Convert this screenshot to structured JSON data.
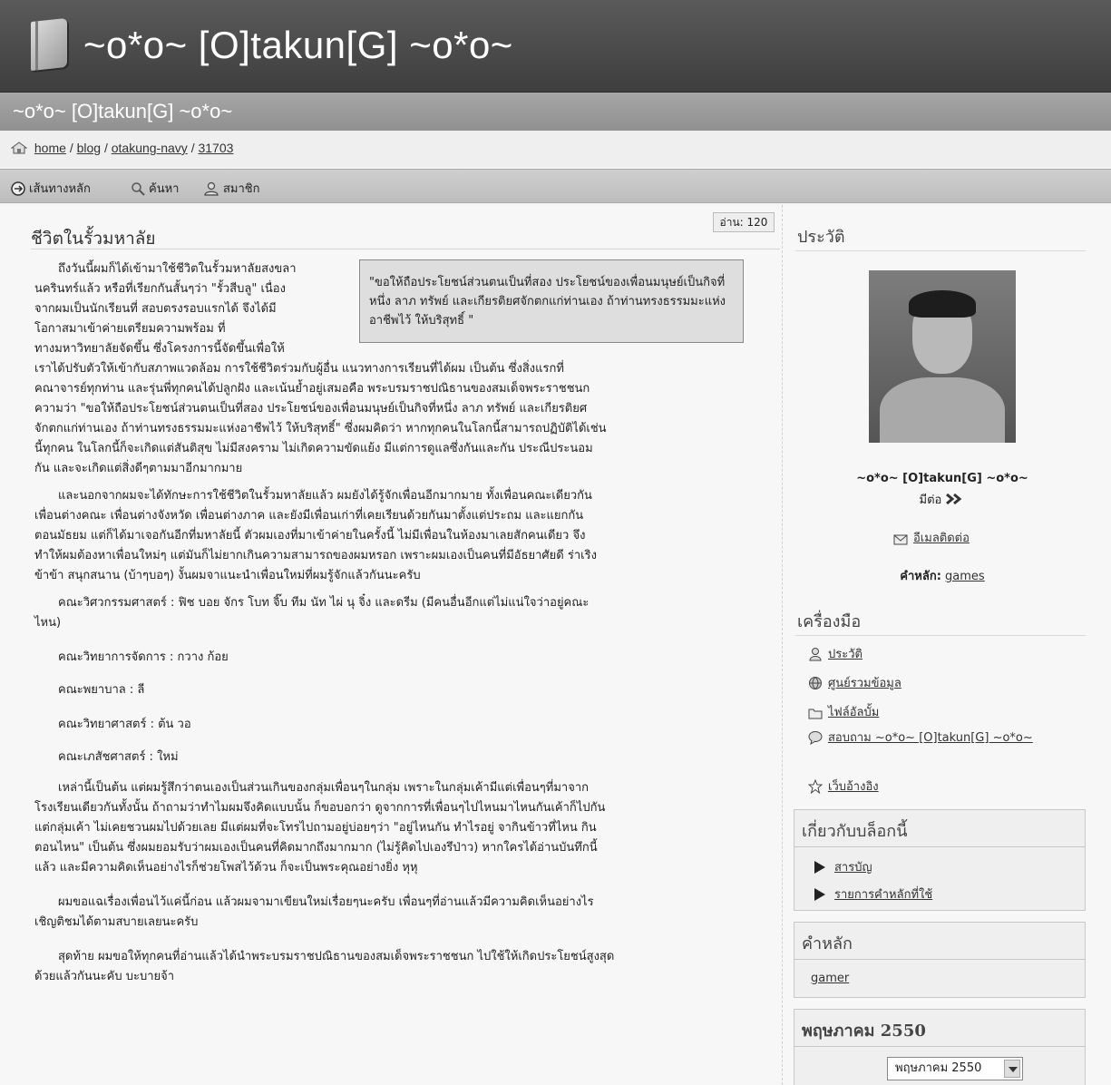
{
  "header": {
    "title": "~o*o~ [O]takun[G] ~o*o~",
    "subtitle": "~o*o~ [O]takun[G] ~o*o~"
  },
  "breadcrumb": {
    "home": "home",
    "blog": "blog",
    "user": "otakung-navy",
    "id": "31703",
    "sep": "/"
  },
  "nav": {
    "main": "เส้นทางหลัก",
    "search": "ค้นหา",
    "members": "สมาชิก"
  },
  "post": {
    "title": "ชีวิตในรั้วมหาลัย",
    "read_count": "อ่าน: 120",
    "quote": "\"ขอให้ถือประโยชน์ส่วนตนเป็นที่สอง ประโยชน์ของเพื่อนมนุษย์เป็นกิจที่หนึ่ง ลาภ ทรัพย์ และเกียรติยศจักตกแก่ท่านเอง ถ้าท่านทรงธรรมมะแห่งอาชีพไว้ ให้บริสุทธิ์ \"",
    "p1_lines": [
      "ถึงวันนี้ผมก็ได้เข้ามาใช้ชีวิตในรั้วมหาลัยสงขลา",
      "นครินทร์แล้ว หรือที่เรียกกันสั้นๆว่า \"รั้วสีบลู\" เนื่อง",
      "จากผมเป็นนักเรียนที่ สอบตรงรอบแรกได้ จึงได้มี",
      "โอกาสมาเข้าค่ายเตรียมความพร้อม ที่",
      "ทางมหาวิทยาลัยจัดขึ้น ซึ่งโครงการนี้จัดขึ้นเพื่อให้",
      "เราได้ปรับตัวให้เข้ากับสภาพแวดล้อม การใช้ชีวิตร่วมกับผู้อื่น แนวทางการเรียนที่ได้ผม เป็นต้น ซึ่งสิ่งแรกที่",
      "คณาจารย์ทุกท่าน และรุ่นพี่ทุกคนได้ปลูกฝัง และเน้นย้ำอยู่เสมอคือ พระบรมราชปณิธานของสมเด็จพระราชชนก",
      "ความว่า \"ขอให้ถือประโยชน์ส่วนตนเป็นที่สอง ประโยชน์ของเพื่อนมนุษย์เป็นกิจที่หนึ่ง ลาภ ทรัพย์ และเกียรติยศ",
      "จักตกแก่ท่านเอง ถ้าท่านทรงธรรมมะแห่งอาชีพไว้ ให้บริสุทธิ์\" ซึ่งผมคิดว่า หากทุกคนในโลกนี้สามารถปฏิบัติได้เช่น",
      "นี้ทุกคน ในโลกนี้ก็จะเกิดแต่สันติสุข ไม่มีสงคราม ไม่เกิดความขัดแย้ง มีแต่การดูแลซึ่งกันและกัน ประณีประนอม",
      "กัน และจะเกิดแต่สิ่งดีๆตามมาอีกมากมาย"
    ],
    "p2_lines": [
      "และนอกจากผมจะได้ทักษะการใช้ชีวิตในรั้วมหาลัยแล้ว ผมยังได้รู้จักเพื่อนอีกมากมาย ทั้งเพื่อนคณะเดียวกัน",
      "เพื่อนต่างคณะ เพื่อนต่างจังหวัด เพื่อนต่างภาค และยังมีเพื่อนเก่าที่เคยเรียนด้วยกันมาตั้งแต่ประถม และแยกกัน",
      "ตอนมัธยม แต่ก็ได้มาเจอกันอีกที่มหาลัยนี้ ตัวผมเองที่มาเข้าค่ายในครั้งนี้ ไม่มีเพื่อนในห้องมาเลยสักคนเดียว จึง",
      "ทำให้ผมต้องหาเพื่อนใหม่ๆ แต่มันก็ไม่ยากเกินความสามารถของผมหรอก เพราะผมเองเป็นคนที่มีอัธยาศัยดี ร่าเริง",
      "ข้าข้า สนุกสนาน (บ้าๆบอๆ) งั้นผมจาแนะนำเพื่อนใหม่ที่ผมรู้จักแล้วกันนะครับ"
    ],
    "p3_lines": [
      "คณะวิศวกรรมศาสตร์ : ฟิช บอย จักร โบท จิ๊บ ทีม นัท ไผ่ นุ จิ๋ง และดรีม (มีคนอื่นอีกแต่ไม่แน่ใจว่าอยู่คณะ",
      "ไหน)"
    ],
    "p4": "คณะวิทยาการจัดการ : กวาง ก้อย",
    "p5": "คณะพยาบาล : ลี",
    "p6": "คณะวิทยาศาสตร์ : ต้น วอ",
    "p7": "คณะเภสัชศาสตร์ : ใหม่",
    "p8_lines": [
      "เหล่านี้เป็นต้น แต่ผมรู้สึกว่าตนเองเป็นส่วนเกินของกลุ่มเพื่อนๆในกลุ่ม เพราะในกลุ่มเค้ามีแต่เพื่อนๆที่มาจาก",
      "โรงเรียนเดียวกันทั้งนั้น ถ้าถามว่าทำไมผมจึงคิดแบบนั้น ก็ขอบอกว่า ดูจากการที่เพื่อนๆไปไหนมาไหนกันเค้าก็ไปกัน",
      "แต่กลุ่มเค้า ไม่เคยชวนผมไปด้วยเลย มีแต่ผมที่จะโทรไปถามอยู่บ่อยๆว่า \"อยู่ไหนกัน ทำไรอยู่ จากินข้าวที่ไหน กิน",
      "ตอนไหน\" เป็นต้น ซึ่งผมยอมรับว่าผมเองเป็นคนที่คิดมากถึงมากมาก (ไม่รู้คิดไปเองรึป่าว) หากใครได้อ่านบันทึกนี้",
      "แล้ว และมีความคิดเห็นอย่างไรก็ช่วยโพสไว้ด้วน ก็จะเป็นพระคุณอย่างยิ่ง หุหุ"
    ],
    "p9_lines": [
      "ผมขอแฉเรื่องเพื่อนไว้แค่นี้ก่อน แล้วผมจามาเขียนใหม่เรื่อยๆนะครับ เพื่อนๆที่อ่านแล้วมีความคิดเห็นอย่างไร",
      "เชิญติชมได้ตามสบายเลยนะครับ"
    ],
    "p10_lines": [
      "สุดท้าย ผมขอให้ทุกคนที่อ่านแล้วได้นำพระบรมราชปณิธานของสมเด็จพระราชชนก ไปใช้ให้เกิดประโยชน์สูงสุด",
      "ด้วยแล้วกันนะคับ บะบายจ้า"
    ]
  },
  "sidebar": {
    "profile_heading": "ประวัติ",
    "name": "~o*o~ [O]takun[G] ~o*o~",
    "more": "มีต่อ",
    "email": "อีเมลติดต่อ",
    "keyword_label": "คำหลัก:",
    "keyword": "games",
    "tools_heading": "เครื่องมือ",
    "tools": [
      "ประวัติ",
      "ศูนย์รวมข้อมูล",
      "ไฟล์อัลบั้ม",
      "สอบถาม ~o*o~ [O]takun[G] ~o*o~",
      "เว็บอ้างอิง"
    ],
    "about_heading": "เกี่ยวกับบล็อกนี้",
    "about_links": [
      "สารบัญ",
      "รายการคำหลักที่ใช้"
    ],
    "tags_heading": "คำหลัก",
    "tag": "gamer",
    "calendar_heading": "พฤษภาคม 2550",
    "calendar_select": "พฤษภาคม 2550"
  },
  "colors": {
    "titlebar": "#4a4a4a",
    "subbar": "#9c9c9c",
    "navbar": "#c6c6c6",
    "quote_bg": "#dedede"
  }
}
